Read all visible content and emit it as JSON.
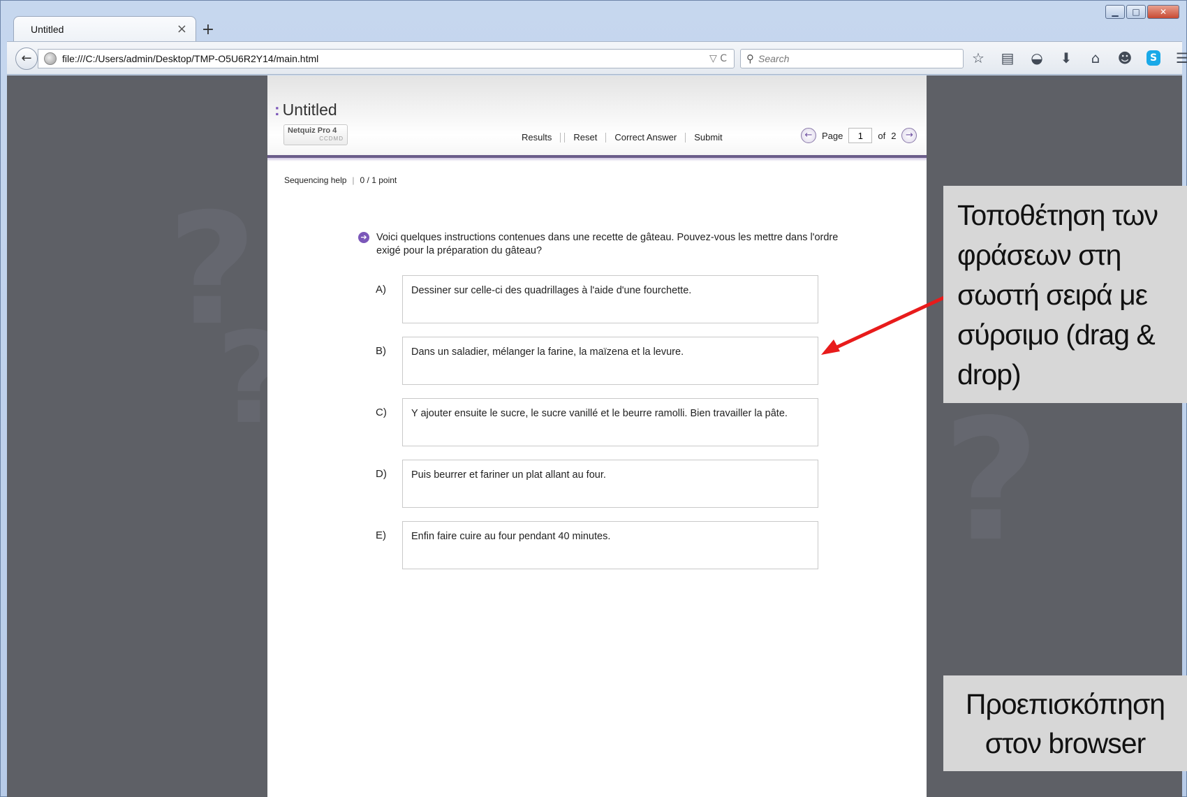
{
  "window": {
    "controls": {
      "minimize": "▁",
      "maximize": "□",
      "close": "✕"
    }
  },
  "browser": {
    "tab": {
      "title": "Untitled",
      "close_glyph": "×"
    },
    "new_tab_glyph": "+",
    "back_glyph": "←",
    "url": "file:///C:/Users/admin/Desktop/TMP-O5U6R2Y14/main.html",
    "url_tools": "▽ C",
    "search_placeholder": "Search",
    "toolbar_icons": [
      "star-icon",
      "reading-list-icon",
      "pocket-icon",
      "download-icon",
      "home-icon",
      "chat-icon",
      "skype-icon",
      "menu-icon"
    ]
  },
  "quiz": {
    "title": "Untitled",
    "logo": {
      "name": "Netquiz Pro 4",
      "sub": "CCDMD"
    },
    "actions": {
      "results": "Results",
      "reset": "Reset",
      "correct_answer": "Correct Answer",
      "submit": "Submit"
    },
    "pager": {
      "label": "Page",
      "current": "1",
      "of_label": "of",
      "total": "2"
    },
    "meta": {
      "help": "Sequencing help",
      "score": "0 / 1 point"
    },
    "question": "Voici quelques instructions contenues dans une recette de gâteau. Pouvez-vous les mettre dans l'ordre exigé pour la préparation du gâteau?",
    "items": [
      {
        "letter": "A)",
        "text": "Dessiner sur celle-ci des quadrillages à l'aide d'une fourchette."
      },
      {
        "letter": "B)",
        "text": "Dans un saladier, mélanger la farine, la maïzena et la levure."
      },
      {
        "letter": "C)",
        "text": "Y ajouter ensuite le sucre, le sucre vanillé et le beurre ramolli. Bien travailler la pâte."
      },
      {
        "letter": "D)",
        "text": "Puis beurrer et fariner un plat allant au four."
      },
      {
        "letter": "E)",
        "text": "Enfin faire cuire au four pendant 40 minutes."
      }
    ]
  },
  "annotations": {
    "drag_drop": "Τοποθέτηση των φράσεων στη σωστή σειρά με σύρσιμο (drag & drop)",
    "preview": "Προεπισκόπηση στον browser",
    "arrow_color": "#e81b1b"
  },
  "colors": {
    "accent": "#7b57b9",
    "header_rule": "#6b5d8a",
    "viewport_bg": "#5e6066"
  }
}
